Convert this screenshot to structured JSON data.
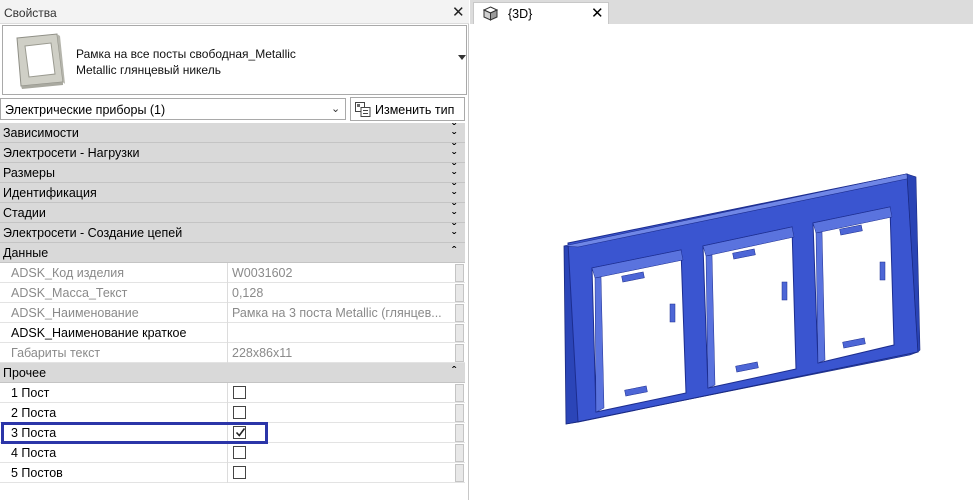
{
  "properties": {
    "title": "Свойства",
    "close_glyph": "✕",
    "type": {
      "line1": "Рамка на все посты свободная_Metallic",
      "line2": "Metallic глянцевый никель"
    },
    "category_filter": "Электрические приборы (1)",
    "edit_type_label": "Изменить тип",
    "collapsed_groups": [
      "Зависимости",
      "Электросети - Нагрузки",
      "Размеры",
      "Идентификация",
      "Стадии",
      "Электросети - Создание цепей"
    ],
    "data_group": {
      "label": "Данные",
      "rows": [
        {
          "name": "ADSK_Код изделия",
          "value": "W0031602"
        },
        {
          "name": "ADSK_Масса_Текст",
          "value": "0,128"
        },
        {
          "name": "ADSK_Наименование",
          "value": "Рамка на 3 поста Metallic (глянцев..."
        },
        {
          "name": "ADSK_Наименование краткое",
          "value": ""
        },
        {
          "name": "Габариты текст",
          "value": "228x86x11"
        }
      ]
    },
    "other_group": {
      "label": "Прочее",
      "rows": [
        {
          "name": "1 Пост",
          "checked": false
        },
        {
          "name": "2 Поста",
          "checked": false
        },
        {
          "name": "3 Поста",
          "checked": true
        },
        {
          "name": "4 Поста",
          "checked": false
        },
        {
          "name": "5 Постов",
          "checked": false
        }
      ]
    },
    "colors": {
      "highlight": "#2b35a8",
      "group_bg": "#d9d9d9"
    }
  },
  "view": {
    "tab_label": "{3D}",
    "close_glyph": "✕",
    "model_color": "#3a55d0"
  }
}
